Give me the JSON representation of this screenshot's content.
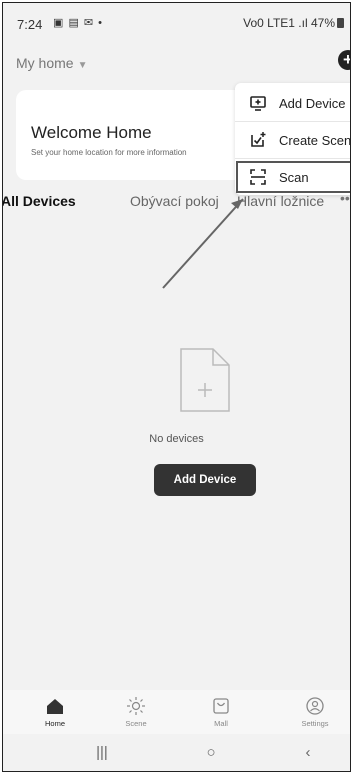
{
  "status_bar": {
    "time": "7:24",
    "icons": "▣ ▤ ✉ •",
    "right": "Vo0 LTE1 .ıl 47%"
  },
  "header": {
    "home_title": "My home"
  },
  "welcome": {
    "title": "Welcome Home",
    "subtitle": "Set your home location for more information"
  },
  "tabs": [
    "All Devices",
    "Obývací pokoj",
    "Hlavní ložnice",
    "••"
  ],
  "dropdown": {
    "items": [
      {
        "label": "Add Device",
        "icon": "add-device-icon"
      },
      {
        "label": "Create Scene",
        "icon": "create-scene-icon"
      },
      {
        "label": "Scan",
        "icon": "scan-icon"
      }
    ]
  },
  "empty_state": {
    "text": "No devices",
    "button": "Add Device"
  },
  "bottom_nav": {
    "items": [
      {
        "label": "Home",
        "icon": "home-icon"
      },
      {
        "label": "Scene",
        "icon": "scene-icon"
      },
      {
        "label": "Mall",
        "icon": "mall-icon"
      },
      {
        "label": "Settings",
        "icon": "settings-icon"
      }
    ]
  },
  "system_nav": {
    "recents": "|||",
    "home": "○",
    "back": "‹"
  },
  "colors": {
    "accent": "#222222",
    "background": "#f2f2f2"
  }
}
